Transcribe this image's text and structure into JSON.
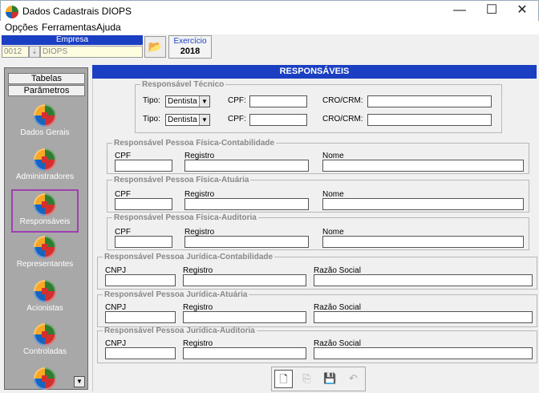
{
  "window": {
    "title": "Dados Cadastrais DIOPS",
    "controls": [
      "—",
      "☐",
      "✕"
    ]
  },
  "menu": [
    "Opções",
    "Ferramentas",
    "Ajuda"
  ],
  "empresa": {
    "header": "Empresa",
    "code": "0012",
    "name": "DIOPS"
  },
  "exercicio": {
    "label": "Exercício",
    "value": "2018"
  },
  "sidebar": {
    "tabs": [
      "Tabelas",
      "Parâmetros"
    ],
    "items": [
      "Dados Gerais",
      "Administradores",
      "Responsáveis",
      "Representantes",
      "Acionistas",
      "Controladas"
    ],
    "selected": "Responsáveis"
  },
  "main": {
    "title": "RESPONSÁVEIS",
    "tecnico": {
      "legend": "Responsável Técnico",
      "rows": [
        {
          "tipo_label": "Tipo:",
          "tipo_value": "Dentista",
          "cpf_label": "CPF:",
          "cro_label": "CRO/CRM:"
        },
        {
          "tipo_label": "Tipo:",
          "tipo_value": "Dentista",
          "cpf_label": "CPF:",
          "cro_label": "CRO/CRM:"
        }
      ]
    },
    "pf_groups": [
      {
        "legend": "Responsável Pessoa Física-Contabilidade",
        "cpf": "CPF",
        "registro": "Registro",
        "nome": "Nome"
      },
      {
        "legend": "Responsável Pessoa Física-Atuária",
        "cpf": "CPF",
        "registro": "Registro",
        "nome": "Nome"
      },
      {
        "legend": "Responsável Pessoa Física-Auditoria",
        "cpf": "CPF",
        "registro": "Registro",
        "nome": "Nome"
      }
    ],
    "pj_groups": [
      {
        "legend": "Responsável Pessoa Jurídica-Contabilidade",
        "cnpj": "CNPJ",
        "registro": "Registro",
        "razao": "Razão Social"
      },
      {
        "legend": "Responsável Pessoa Jurídica-Atuária",
        "cnpj": "CNPJ",
        "registro": "Registro",
        "razao": "Razão Social"
      },
      {
        "legend": "Responsável Pessoa Jurídica-Auditoria",
        "cnpj": "CNPJ",
        "registro": "Registro",
        "razao": "Razão Social"
      }
    ]
  }
}
